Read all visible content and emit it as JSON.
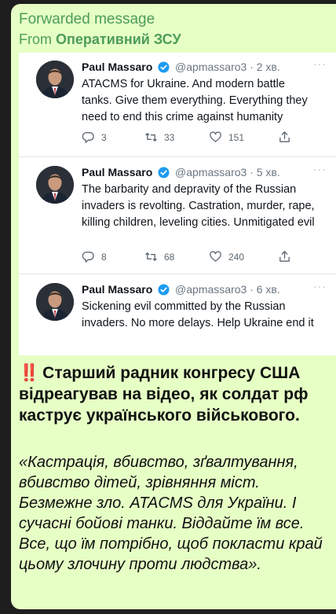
{
  "forwarded": {
    "title": "Forwarded message",
    "from_prefix": "From",
    "channel": "Оперативний ЗСУ"
  },
  "tweets": [
    {
      "name": "Paul Massaro",
      "handle": "@apmassaro3 · 2 хв.",
      "text": "ATACMS for Ukraine. And modern battle tanks. Give them everything. Everything they need to end this crime against humanity",
      "replies": "3",
      "retweets": "33",
      "likes": "151",
      "more": "···"
    },
    {
      "name": "Paul Massaro",
      "handle": "@apmassaro3 · 5 хв.",
      "text": "The barbarity and depravity of the Russian invaders is revolting. Castration, murder, rape, killing children, leveling cities. Unmitigated evil",
      "replies": "8",
      "retweets": "68",
      "likes": "240",
      "more": "···"
    },
    {
      "name": "Paul Massaro",
      "handle": "@apmassaro3 · 6 хв.",
      "text": "Sickening evil committed by the Russian invaders. No more delays. Help Ukraine end it",
      "more": "···"
    }
  ],
  "message": {
    "bang": "‼️",
    "headline": "Старший радник конгресу США відреагував на відео, як солдат рф каструє українського військового.",
    "quote": "«Кастрація, вбивство, зґвалтування, вбивство дітей, зрівняння міст. Безмежне зло. ATACMS для України. І сучасні бойові танки. Віддайте їм все. Все, що їм потрібно, щоб покласти край цьому злочину проти людства»."
  },
  "colors": {
    "bubble": "#e6ffc5",
    "forward_accent": "#4c9d5a",
    "verified": "#1d9bf0",
    "bang": "#e02b20"
  }
}
